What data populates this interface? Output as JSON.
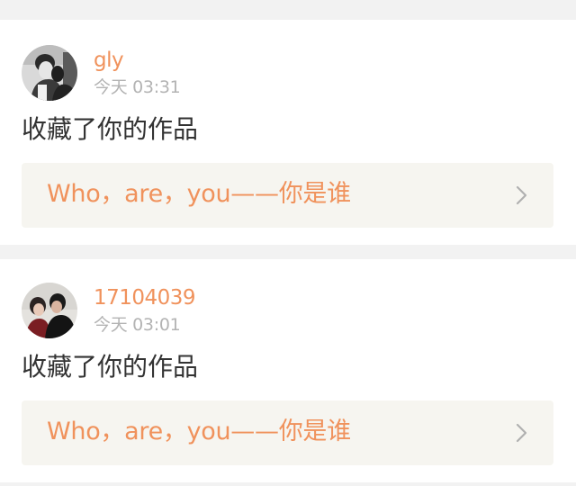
{
  "theme": {
    "accent": "#f0925c",
    "text": "#333333",
    "muted": "#b3b3b3",
    "panel_bg": "#f6f5f0",
    "page_bg": "#f2f2f2"
  },
  "notifications": [
    {
      "username": "gly",
      "time": "今天 03:31",
      "action": "收藏了你的作品",
      "work_title": "Who，are，you——你是谁",
      "avatar_icon": "user-avatar",
      "link_icon": "chevron-right-icon"
    },
    {
      "username": "17104039",
      "time": "今天 03:01",
      "action": "收藏了你的作品",
      "work_title": "Who，are，you——你是谁",
      "avatar_icon": "user-avatar",
      "link_icon": "chevron-right-icon"
    }
  ]
}
